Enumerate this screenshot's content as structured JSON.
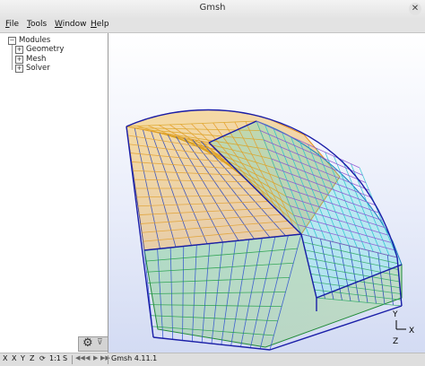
{
  "window": {
    "title": "Gmsh",
    "close_icon": "close-icon"
  },
  "menu": {
    "items": [
      {
        "label": "File",
        "underline": "F",
        "rest": "ile"
      },
      {
        "label": "Tools",
        "underline": "T",
        "rest": "ools"
      },
      {
        "label": "Window",
        "underline": "W",
        "rest": "indow"
      },
      {
        "label": "Help",
        "underline": "H",
        "rest": "elp"
      }
    ]
  },
  "tree": {
    "root": {
      "label": "Modules",
      "expander": "⊟"
    },
    "children": [
      {
        "label": "Geometry",
        "expander": "⊞"
      },
      {
        "label": "Mesh",
        "expander": "⊞"
      },
      {
        "label": "Solver",
        "expander": "⊞"
      }
    ]
  },
  "toolbar": {
    "gear_icon": "gear-icon",
    "filter_icon": "filter-icon"
  },
  "axes": {
    "y_label": "Y",
    "z_label": "Z",
    "x_label": "X"
  },
  "status": {
    "x": "X",
    "y": "Y",
    "z": "Z",
    "rotate_icon": "rotate-icon",
    "scale": "1:1",
    "s": "S",
    "version": "Gmsh 4.11.1"
  },
  "colors": {
    "mesh_blue": "#1f2fb3",
    "mesh_orange": "#f0a020",
    "mesh_green": "#22b04a",
    "mesh_cyan": "#2bd3d3"
  }
}
